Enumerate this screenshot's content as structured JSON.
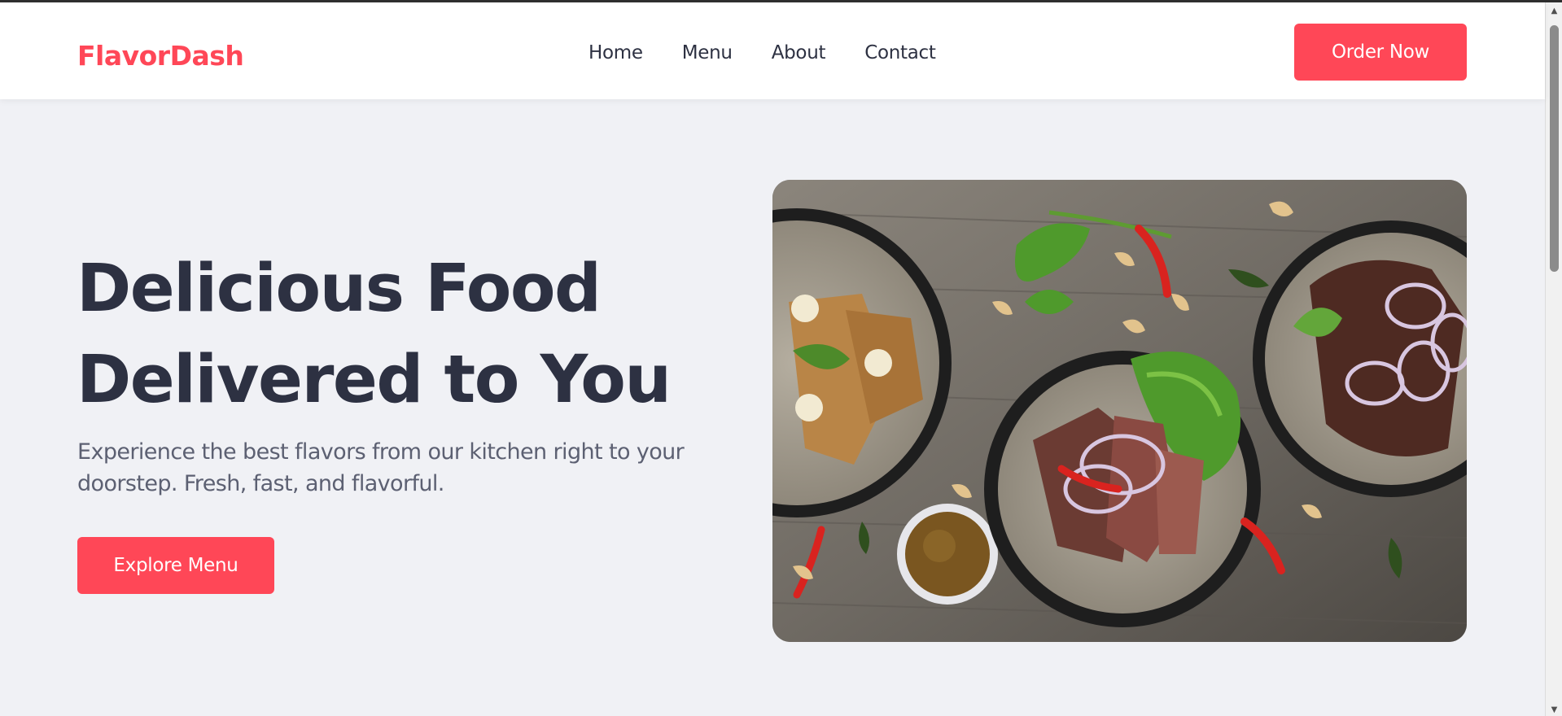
{
  "header": {
    "logo": "FlavorDash",
    "nav": [
      {
        "label": "Home"
      },
      {
        "label": "Menu"
      },
      {
        "label": "About"
      },
      {
        "label": "Contact"
      }
    ],
    "cta_label": "Order Now"
  },
  "hero": {
    "title_line1": "Delicious Food",
    "title_line2": "Delivered to You",
    "subtitle": "Experience the best flavors from our kitchen right to your doorstep. Fresh, fast, and flavorful.",
    "cta_label": "Explore Menu"
  },
  "colors": {
    "accent": "#ff4757",
    "heading": "#2d3142",
    "body_text": "#5c6072",
    "page_bg": "#f0f1f5"
  },
  "icons": {
    "scroll_up": "triangle-up-icon",
    "scroll_down": "triangle-down-icon"
  }
}
